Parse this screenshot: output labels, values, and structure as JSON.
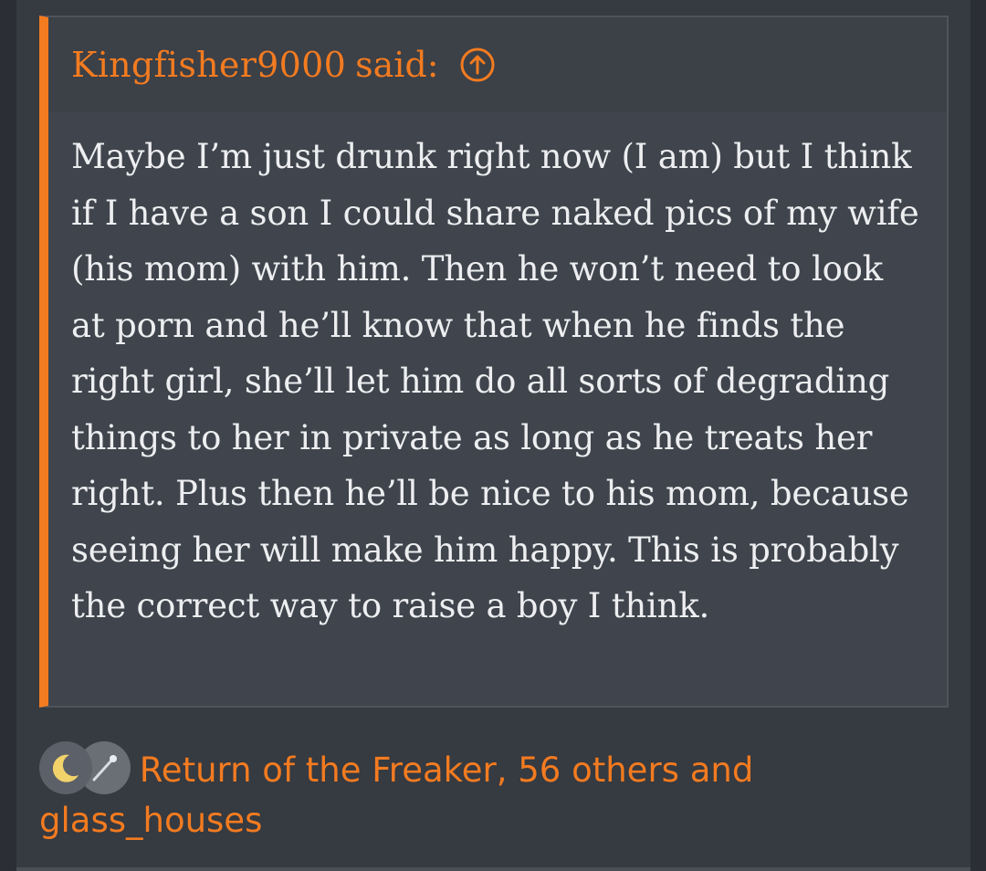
{
  "quote": {
    "author": "Kingfisher9000",
    "said_label": "said:",
    "jump_icon": "arrow-up-circle-icon",
    "body": "Maybe I’m just drunk right now (I am) but I think if I have a son I could share naked pics of my wife (his mom) with him. Then he won’t need to look at porn and he’ll know that when he finds the right girl, she’ll let him do all sorts of degrading things to her in private as long as he treats her right. Plus then he’ll be nice to his mom, because seeing her will make him happy. This is probably the correct way to raise a boy I think."
  },
  "reactions": {
    "icons": [
      "crescent-moon-icon",
      "magic-wand-icon"
    ],
    "text_part1": "Return of the Freaker, 56 others and",
    "text_part2": "glass_houses"
  },
  "colors": {
    "accent": "#f37b20",
    "background": "#363a41",
    "quote_background": "#40444c",
    "text": "#eceef0"
  }
}
